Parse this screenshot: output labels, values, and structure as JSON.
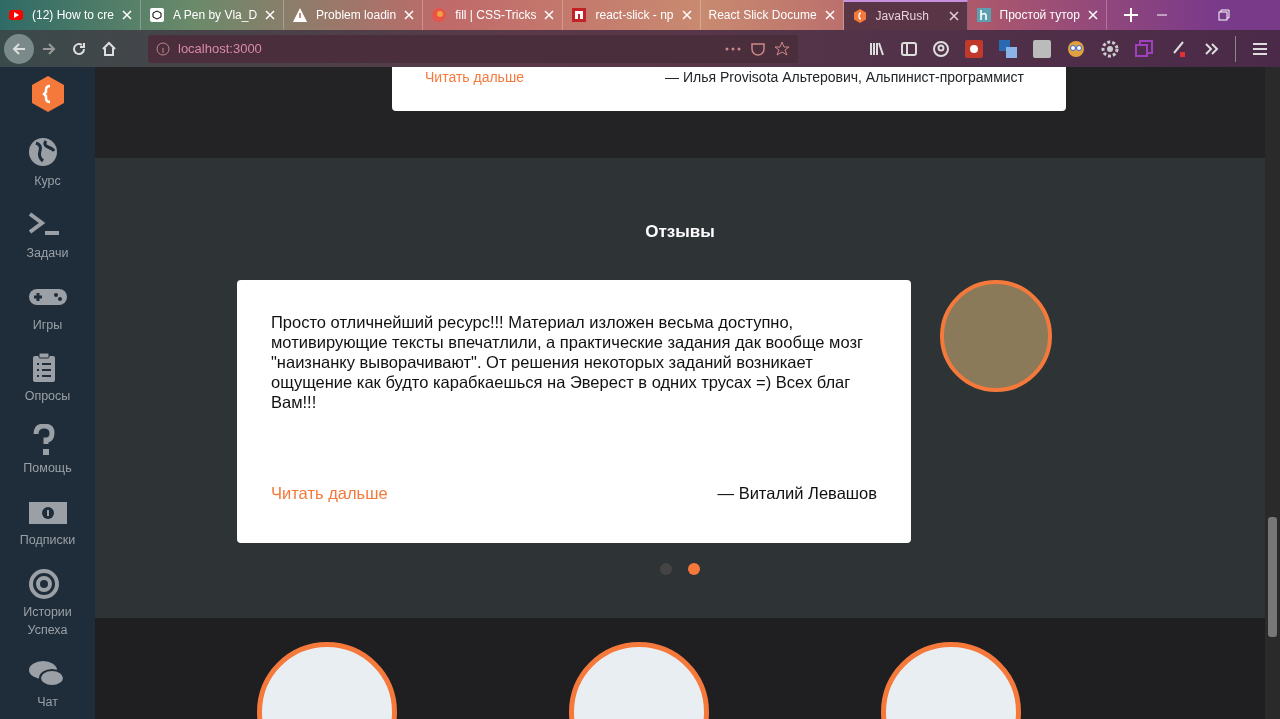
{
  "browser": {
    "tabs": [
      {
        "title": "(12) How to cre",
        "selected": false
      },
      {
        "title": "A Pen by Vla_D",
        "selected": false
      },
      {
        "title": "Problem loadin",
        "selected": false
      },
      {
        "title": "fill | CSS-Tricks",
        "selected": false
      },
      {
        "title": "react-slick - np",
        "selected": false
      },
      {
        "title": "React Slick Docume",
        "selected": false
      },
      {
        "title": "JavaRush",
        "selected": true
      },
      {
        "title": "Простой тутор",
        "selected": false
      }
    ],
    "address": "localhost:3000"
  },
  "sidebar": {
    "items": [
      {
        "label": "Курс"
      },
      {
        "label": "Задачи"
      },
      {
        "label": "Игры"
      },
      {
        "label": "Опросы"
      },
      {
        "label": "Помощь"
      },
      {
        "label": "Подписки"
      },
      {
        "label": "Истории Успеха"
      },
      {
        "label": "Чат"
      }
    ]
  },
  "previous_review": {
    "read_more": "Читать дальше",
    "author": "— Илья Provisota Альтерович, Альпинист-программист"
  },
  "reviews": {
    "title": "Отзывы",
    "review": {
      "text": "Просто отличнейший ресурс!!! Материал изложен весьма доступно, мотивирующие тексты впечатлили, а практические задания дак вообще мозг \"наизнанку выворачивают\". От решения некоторых заданий возникает ощущение как будто карабкаешься на Эверест в одних трусах =) Всех благ Вам!!!",
      "read_more": "Читать дальше",
      "author": "— Виталий Левашов"
    },
    "dots": [
      {
        "selected": false
      },
      {
        "selected": true
      }
    ]
  }
}
